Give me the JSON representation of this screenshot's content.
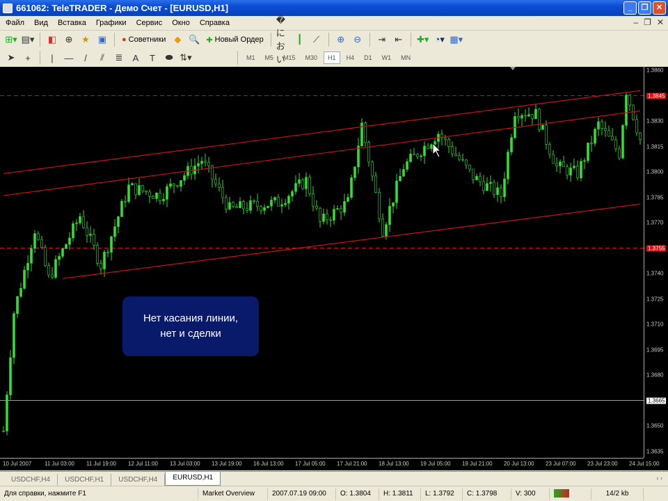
{
  "window": {
    "title": "661062: TeleTRADER - Демо Счет - [EURUSD,H1]"
  },
  "menu": [
    "Файл",
    "Вид",
    "Вставка",
    "Графики",
    "Сервис",
    "Окно",
    "Справка"
  ],
  "toolbar": {
    "experts_label": "Советники",
    "new_order_label": "Новый Ордер"
  },
  "timeframes": [
    "M1",
    "M5",
    "M15",
    "M30",
    "H1",
    "H4",
    "D1",
    "W1",
    "MN"
  ],
  "active_timeframe": "H1",
  "chart": {
    "price_labels": [
      "1.3860",
      "1.3830",
      "1.3815",
      "1.3800",
      "1.3785",
      "1.3770",
      "1.3740",
      "1.3725",
      "1.3710",
      "1.3695",
      "1.3680",
      "1.3650",
      "1.3635"
    ],
    "level_upper": "1.3845",
    "level_lower": "1.3755",
    "current_price": "1.3665",
    "time_labels": [
      "10 Jul 2007",
      "11 Jul 03:00",
      "11 Jul 19:00",
      "12 Jul 11:00",
      "13 Jul 03:00",
      "13 Jul 19:00",
      "16 Jul 13:00",
      "17 Jul 05:00",
      "17 Jul 21:00",
      "18 Jul 13:00",
      "19 Jul 05:00",
      "19 Jul 21:00",
      "20 Jul 13:00",
      "23 Jul 07:00",
      "23 Jul 23:00",
      "24 Jul 15:00"
    ],
    "price_path": [
      [
        0,
        1.3647
      ],
      [
        3,
        1.3717
      ],
      [
        9,
        1.3766
      ],
      [
        13,
        1.3737
      ],
      [
        22,
        1.3774
      ],
      [
        28,
        1.3745
      ],
      [
        36,
        1.3791
      ],
      [
        45,
        1.3786
      ],
      [
        57,
        1.3807
      ],
      [
        65,
        1.3778
      ],
      [
        79,
        1.3782
      ],
      [
        87,
        1.3795
      ],
      [
        91,
        1.377
      ],
      [
        99,
        1.3782
      ],
      [
        103,
        1.3828
      ],
      [
        109,
        1.3766
      ],
      [
        115,
        1.3803
      ],
      [
        125,
        1.3823
      ],
      [
        135,
        1.3797
      ],
      [
        143,
        1.3786
      ],
      [
        147,
        1.3836
      ],
      [
        153,
        1.3834
      ],
      [
        159,
        1.3803
      ],
      [
        165,
        1.3799
      ],
      [
        171,
        1.3828
      ],
      [
        177,
        1.3811
      ],
      [
        179,
        1.3848
      ],
      [
        183,
        1.3819
      ]
    ],
    "channel": {
      "upper": [
        [
          0,
          1.3799
        ],
        [
          183,
          1.3848
        ]
      ],
      "middle": [
        [
          0,
          1.3786
        ],
        [
          183,
          1.3836
        ]
      ],
      "lower": [
        [
          17,
          1.3737
        ],
        [
          183,
          1.3781
        ]
      ]
    },
    "colors": {
      "bull": "#33dd33",
      "bear": "#33dd33",
      "channel": "#cc1111",
      "level": "#cc1111"
    }
  },
  "annotation": {
    "line1": "Нет касания линии,",
    "line2": "нет и сделки"
  },
  "tabs": [
    "USDCHF,H4",
    "USDCHF,H1",
    "USDCHF,H4",
    "EURUSD,H1"
  ],
  "status": {
    "help": "Для справки, нажмите F1",
    "profile": "Market Overview",
    "datetime": "2007.07.19 09:00",
    "open": "O: 1.3804",
    "high": "H: 1.3811",
    "low": "L: 1.3792",
    "close": "C: 1.3798",
    "volume": "V: 300",
    "traffic": "14/2 kb"
  }
}
